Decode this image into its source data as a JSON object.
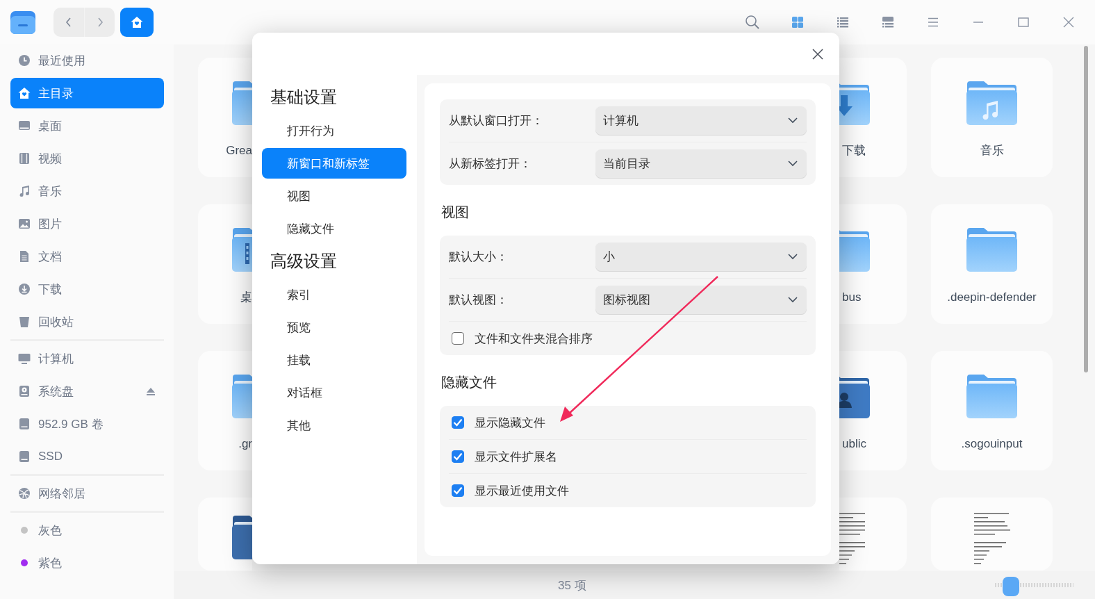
{
  "titlebar": {
    "view_modes": [
      {
        "kind": "icon",
        "selected": true
      },
      {
        "kind": "list",
        "selected": false
      },
      {
        "kind": "split",
        "selected": false
      }
    ]
  },
  "sidebar": {
    "groups": [
      {
        "items": [
          {
            "kind": "recent",
            "label": "最近使用",
            "selected": false
          },
          {
            "kind": "home",
            "label": "主目录",
            "selected": true
          },
          {
            "kind": "desktop",
            "label": "桌面",
            "selected": false
          },
          {
            "kind": "video",
            "label": "视频",
            "selected": false
          },
          {
            "kind": "music",
            "label": "音乐",
            "selected": false
          },
          {
            "kind": "picture",
            "label": "图片",
            "selected": false
          },
          {
            "kind": "document",
            "label": "文档",
            "selected": false
          },
          {
            "kind": "download",
            "label": "下载",
            "selected": false
          },
          {
            "kind": "trash",
            "label": "回收站",
            "selected": false
          }
        ]
      },
      {
        "items": [
          {
            "kind": "computer",
            "label": "计算机",
            "selected": false,
            "ejectable": false
          },
          {
            "kind": "system-disk",
            "label": "系统盘",
            "selected": false,
            "ejectable": true
          },
          {
            "kind": "disk",
            "label": "952.9 GB 卷",
            "selected": false,
            "ejectable": false
          },
          {
            "kind": "disk",
            "label": "SSD",
            "selected": false,
            "ejectable": false
          }
        ]
      },
      {
        "items": [
          {
            "kind": "network",
            "label": "网络邻居",
            "selected": false
          }
        ]
      },
      {
        "items": [
          {
            "kind": "tag",
            "label": "灰色",
            "selected": false,
            "color": "#c4c4c4"
          },
          {
            "kind": "tag",
            "label": "紫色",
            "selected": false,
            "color": "#a12df0"
          }
        ]
      }
    ]
  },
  "files": {
    "rows": [
      {
        "left": {
          "kind": "folder",
          "label": "Grea"
        },
        "middle": {
          "kind": "download-folder",
          "label": "下载"
        },
        "right": {
          "kind": "music-folder",
          "label": "音乐"
        }
      },
      {
        "left": {
          "kind": "desktop-folder",
          "label": "桌"
        },
        "middle": {
          "kind": "folder",
          "label": "bus"
        },
        "right": {
          "kind": "folder",
          "label": ".deepin-defender"
        }
      },
      {
        "left": {
          "kind": "folder",
          "label": ".gr"
        },
        "middle": {
          "kind": "user-folder",
          "label": "ublic"
        },
        "right": {
          "kind": "folder",
          "label": ".sogouinput"
        }
      },
      {
        "left": {
          "kind": "dark-folder"
        },
        "middle": {
          "kind": "text-file"
        },
        "right": {
          "kind": "text-file"
        }
      }
    ]
  },
  "status_bar": {
    "count": "35 项",
    "zoom": {
      "level": 0.2
    }
  },
  "dialog": {
    "nav": [
      {
        "heading": "基础设置",
        "items": [
          {
            "label": "打开行为",
            "selected": false
          },
          {
            "label": "新窗口和新标签",
            "selected": true
          },
          {
            "label": "视图",
            "selected": false
          },
          {
            "label": "隐藏文件",
            "selected": false
          }
        ]
      },
      {
        "heading": "高级设置",
        "items": [
          {
            "label": "索引",
            "selected": false
          },
          {
            "label": "预览",
            "selected": false
          },
          {
            "label": "挂载",
            "selected": false
          },
          {
            "label": "对话框",
            "selected": false
          },
          {
            "label": "其他",
            "selected": false
          }
        ]
      }
    ],
    "sections": [
      {
        "rows": [
          {
            "kind": "select",
            "label": "从默认窗口打开：",
            "value": "计算机"
          },
          {
            "kind": "select",
            "label": "从新标签打开：",
            "value": "当前目录"
          }
        ]
      },
      {
        "title": "视图",
        "rows": [
          {
            "kind": "select",
            "label": "默认大小：",
            "value": "小"
          },
          {
            "kind": "select",
            "label": "默认视图：",
            "value": "图标视图"
          },
          {
            "kind": "checkbox",
            "label": "文件和文件夹混合排序",
            "checked": false
          }
        ]
      },
      {
        "title": "隐藏文件",
        "rows": [
          {
            "kind": "checkbox",
            "label": "显示隐藏文件",
            "checked": true
          },
          {
            "kind": "checkbox",
            "label": "显示文件扩展名",
            "checked": true
          },
          {
            "kind": "checkbox",
            "label": "显示最近使用文件",
            "checked": true
          }
        ]
      }
    ]
  }
}
